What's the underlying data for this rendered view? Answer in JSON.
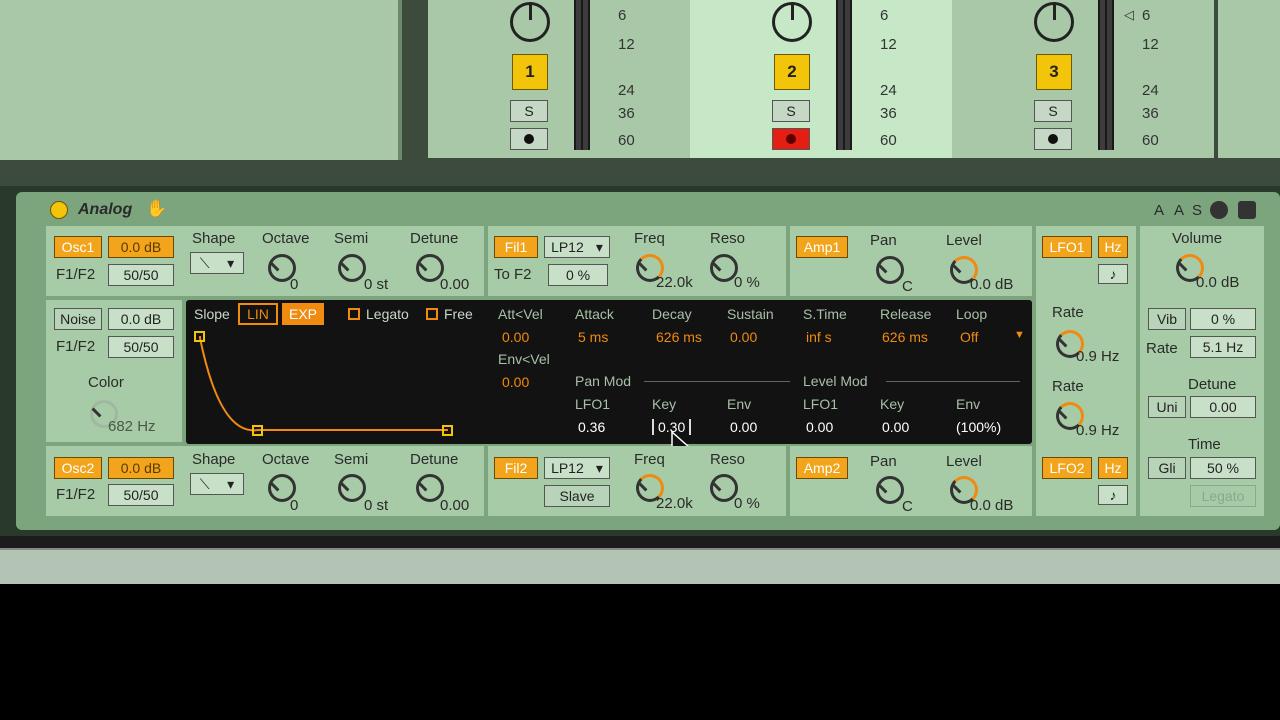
{
  "tracks": [
    {
      "number": "1",
      "solo": "S",
      "ticks": [
        "6",
        "12",
        "24",
        "36",
        "60"
      ],
      "armed": false
    },
    {
      "number": "2",
      "solo": "S",
      "ticks": [
        "6",
        "12",
        "24",
        "36",
        "60"
      ],
      "armed": true
    },
    {
      "number": "3",
      "solo": "S",
      "ticks": [
        "6",
        "12",
        "24",
        "36",
        "60"
      ],
      "armed": false
    }
  ],
  "device": {
    "title": "Analog",
    "header_buttons": [
      "A",
      "A",
      "S"
    ],
    "osc1": {
      "label": "Osc1",
      "gain": "0.0 dB",
      "route_label": "F1/F2",
      "route_value": "50/50",
      "shape_label": "Shape",
      "octave_label": "Octave",
      "octave_value": "0",
      "semi_label": "Semi",
      "semi_value": "0 st",
      "detune_label": "Detune",
      "detune_value": "0.00"
    },
    "noise": {
      "label": "Noise",
      "gain": "0.0 dB",
      "route_label": "F1/F2",
      "route_value": "50/50",
      "color_label": "Color",
      "color_value": "682 Hz"
    },
    "osc2": {
      "label": "Osc2",
      "gain": "0.0 dB",
      "route_label": "F1/F2",
      "route_value": "50/50",
      "shape_label": "Shape",
      "octave_label": "Octave",
      "octave_value": "0",
      "semi_label": "Semi",
      "semi_value": "0 st",
      "detune_label": "Detune",
      "detune_value": "0.00"
    },
    "fil1": {
      "label": "Fil1",
      "type": "LP12",
      "to_label": "To F2",
      "to_value": "0 %",
      "freq_label": "Freq",
      "freq_value": "22.0k",
      "reso_label": "Reso",
      "reso_value": "0 %"
    },
    "fil2": {
      "label": "Fil2",
      "type": "LP12",
      "slave_label": "Slave",
      "freq_label": "Freq",
      "freq_value": "22.0k",
      "reso_label": "Reso",
      "reso_value": "0 %"
    },
    "amp1": {
      "label": "Amp1",
      "pan_label": "Pan",
      "pan_value": "C",
      "level_label": "Level",
      "level_value": "0.0 dB"
    },
    "amp2": {
      "label": "Amp2",
      "pan_label": "Pan",
      "pan_value": "C",
      "level_label": "Level",
      "level_value": "0.0 dB"
    },
    "lfo1": {
      "label": "LFO1",
      "hz": "Hz",
      "rate_label": "Rate",
      "rate_value": "0.9 Hz"
    },
    "lfo2": {
      "label": "LFO2",
      "hz": "Hz",
      "rate_label": "Rate",
      "rate_value": "0.9 Hz"
    },
    "global": {
      "volume_label": "Volume",
      "volume_value": "0.0 dB",
      "vib_label": "Vib",
      "vib_value": "0 %",
      "rate_label": "Rate",
      "rate_value": "5.1 Hz",
      "detune_label": "Detune",
      "uni_label": "Uni",
      "uni_value": "0.00",
      "time_label": "Time",
      "gli_label": "Gli",
      "gli_value": "50 %",
      "legato_label": "Legato"
    },
    "envelope": {
      "slope_label": "Slope",
      "lin_label": "LIN",
      "exp_label": "EXP",
      "legato_label": "Legato",
      "free_label": "Free",
      "attvel_label": "Att<Vel",
      "attvel_value": "0.00",
      "envvel_label": "Env<Vel",
      "envvel_value": "0.00",
      "attack_label": "Attack",
      "attack_value": "5 ms",
      "decay_label": "Decay",
      "decay_value": "626 ms",
      "sustain_label": "Sustain",
      "sustain_value": "0.00",
      "stime_label": "S.Time",
      "stime_value": "inf s",
      "release_label": "Release",
      "release_value": "626 ms",
      "loop_label": "Loop",
      "loop_value": "Off",
      "panmod_label": "Pan Mod",
      "levelmod_label": "Level Mod",
      "pan_lfo_label": "LFO1",
      "pan_lfo_value": "0.36",
      "pan_key_label": "Key",
      "pan_key_value": "0.30",
      "pan_env_label": "Env",
      "pan_env_value": "0.00",
      "lvl_lfo_label": "LFO1",
      "lvl_lfo_value": "0.00",
      "lvl_key_label": "Key",
      "lvl_key_value": "0.00",
      "lvl_env_label": "Env",
      "lvl_env_value": "(100%)"
    }
  }
}
